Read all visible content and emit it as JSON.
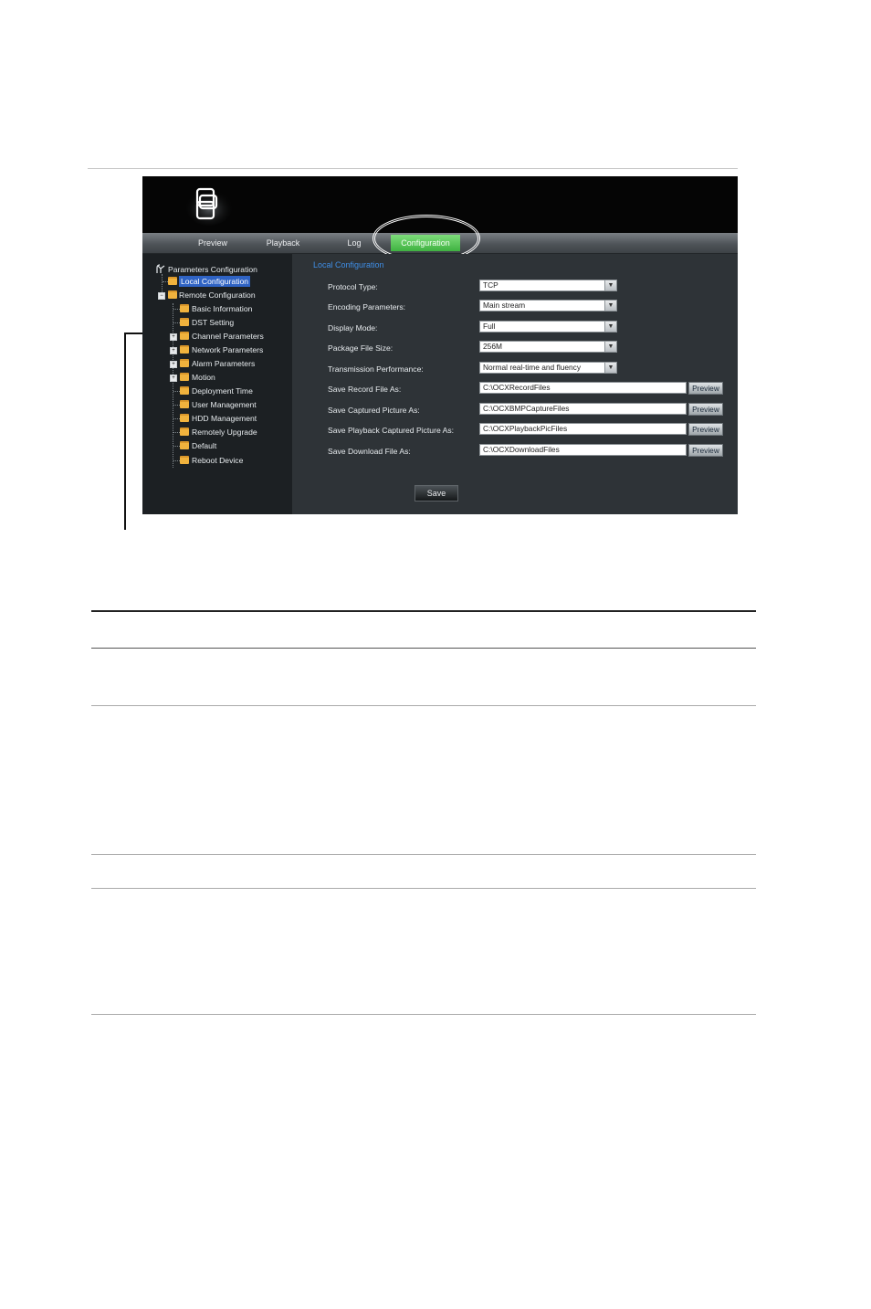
{
  "header": {
    "logo_icon": "stacked-squares-logo-icon"
  },
  "nav": {
    "tabs": [
      {
        "label": "Preview"
      },
      {
        "label": "Playback"
      },
      {
        "label": "Log"
      },
      {
        "label": "Configuration",
        "active": true
      }
    ],
    "active_color": "#4fc24f"
  },
  "tree": {
    "root": "Parameters Configuration",
    "items": [
      {
        "label": "Local Configuration",
        "selected": true
      },
      {
        "label": "Remote Configuration",
        "expander": "-"
      },
      {
        "label": "Basic Information"
      },
      {
        "label": "DST Setting"
      },
      {
        "label": "Channel Parameters",
        "expander": "+"
      },
      {
        "label": "Network Parameters",
        "expander": "+"
      },
      {
        "label": "Alarm Parameters",
        "expander": "+"
      },
      {
        "label": "Motion",
        "expander": "+"
      },
      {
        "label": "Deployment Time"
      },
      {
        "label": "User Management"
      },
      {
        "label": "HDD Management"
      },
      {
        "label": "Remotely Upgrade"
      },
      {
        "label": "Default"
      },
      {
        "label": "Reboot Device"
      }
    ]
  },
  "form": {
    "title": "Local Configuration",
    "title_color": "#3f8ee6",
    "fields": [
      {
        "label": "Protocol Type:",
        "value": "TCP",
        "kind": "select"
      },
      {
        "label": "Encoding Parameters:",
        "value": "Main stream",
        "kind": "select"
      },
      {
        "label": "Display Mode:",
        "value": "Full",
        "kind": "select"
      },
      {
        "label": "Package File Size:",
        "value": "256M",
        "kind": "select"
      },
      {
        "label": "Transmission Performance:",
        "value": "Normal real-time and fluency",
        "kind": "select"
      },
      {
        "label": "Save Record File As:",
        "value": "C:\\OCXRecordFiles",
        "kind": "path",
        "button": "Preview"
      },
      {
        "label": "Save Captured Picture As:",
        "value": "C:\\OCXBMPCaptureFiles",
        "kind": "path",
        "button": "Preview"
      },
      {
        "label": "Save Playback Captured Picture As:",
        "value": "C:\\OCXPlaybackPicFiles",
        "kind": "path",
        "button": "Preview"
      },
      {
        "label": "Save Download File As:",
        "value": "C:\\OCXDownloadFiles",
        "kind": "path",
        "button": "Preview"
      }
    ],
    "save_label": "Save"
  }
}
